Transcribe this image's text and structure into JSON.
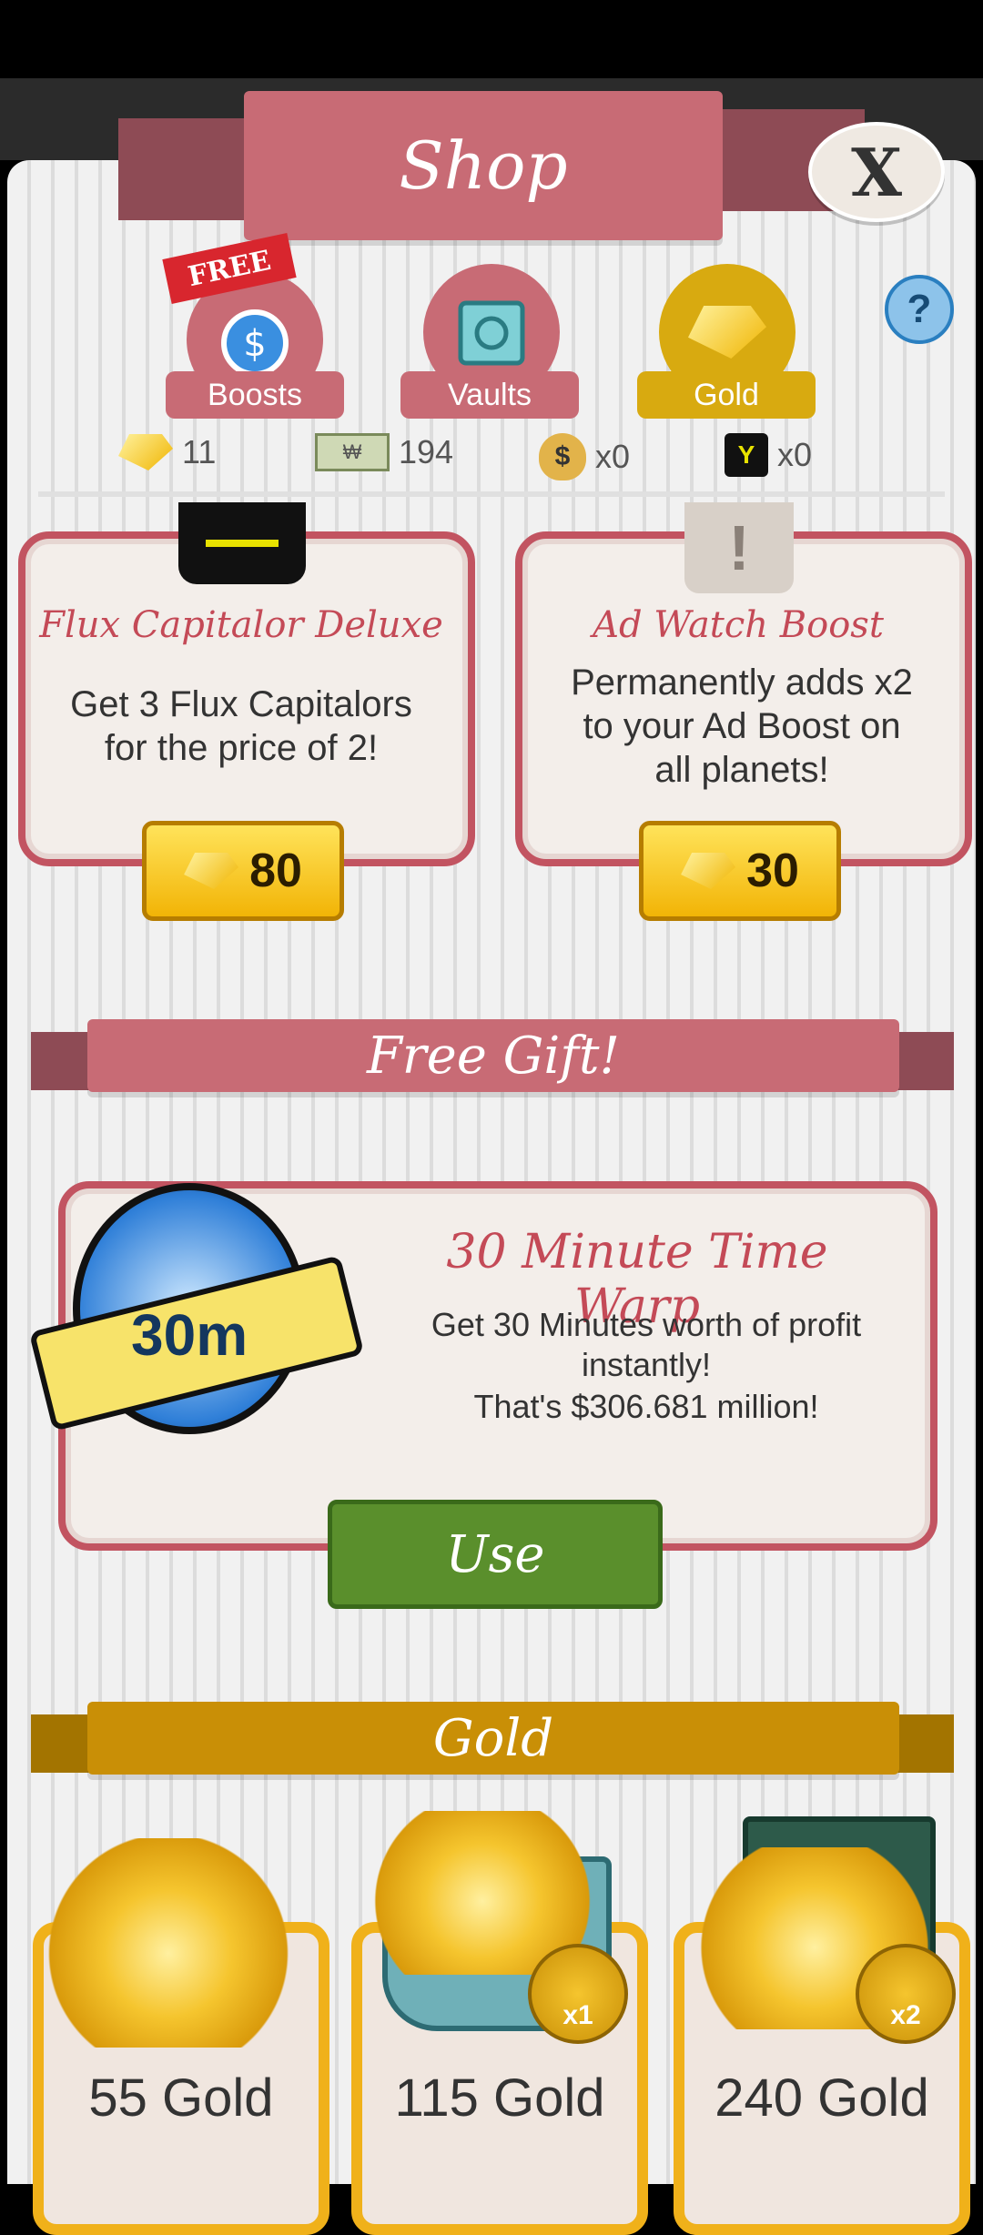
{
  "header": {
    "title": "Shop",
    "close_label": "X"
  },
  "tabs": [
    {
      "label": "Boosts",
      "badge": "FREE"
    },
    {
      "label": "Vaults"
    },
    {
      "label": "Gold"
    }
  ],
  "help_label": "?",
  "currencies": [
    {
      "icon": "gold-gem-icon",
      "value": "11"
    },
    {
      "icon": "megabucks-icon",
      "value": "194"
    },
    {
      "icon": "money-bag-icon",
      "value": "x0"
    },
    {
      "icon": "flux-capitalor-icon",
      "value": "x0"
    }
  ],
  "offers": [
    {
      "title": "Flux Capitalor Deluxe",
      "description": "Get 3 Flux Capitalors for the price of 2!",
      "price": "80"
    },
    {
      "title": "Ad Watch Boost",
      "description": "Permanently adds x2 to your Ad Boost on all planets!",
      "price": "30"
    }
  ],
  "free_gift": {
    "section_title": "Free Gift!",
    "icon_label": "30m",
    "title": "30 Minute Time Warp",
    "line1": "Get 30 Minutes worth of profit instantly!",
    "line2": "That's $306.681 million!",
    "button": "Use"
  },
  "gold_section": {
    "title": "Gold",
    "packs": [
      {
        "label": "55 Gold"
      },
      {
        "label": "115 Gold",
        "multiplier": "x1"
      },
      {
        "label": "240 Gold",
        "multiplier": "x2"
      }
    ]
  },
  "colors": {
    "ribbon": "#c86b75",
    "gold": "#d8aa10",
    "use_button": "#5a8f2c",
    "card_border": "#c25461"
  }
}
